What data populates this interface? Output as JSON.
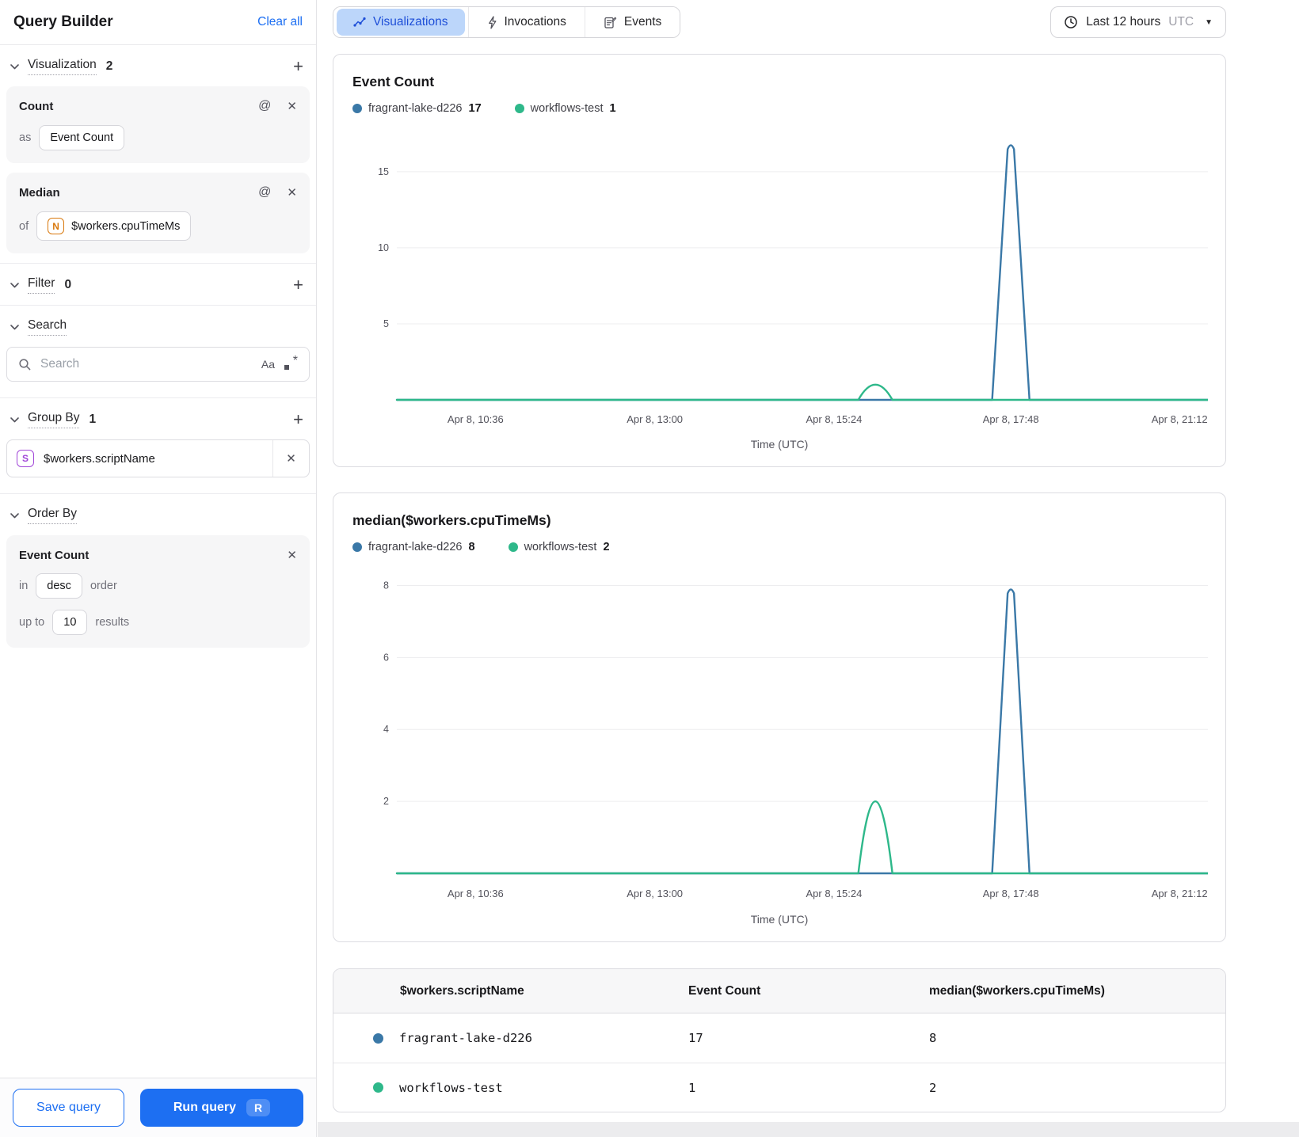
{
  "icons": {
    "at": "@",
    "close": "✕",
    "plus": "+",
    "caret_down": "▼",
    "case_sensitive": "Aa"
  },
  "colors": {
    "blue": "#3A78A7",
    "green": "#2EB88A",
    "accent": "#1D6FF2",
    "tab_active_bg": "#BCD6FA",
    "tab_active_text": "#1E4FD8",
    "badge_n": "#D9790E",
    "badge_s": "#A147D8"
  },
  "sidebar": {
    "title": "Query Builder",
    "clear_all": "Clear all",
    "sections": {
      "visualization": {
        "label": "Visualization",
        "count": "2"
      },
      "filter": {
        "label": "Filter",
        "count": "0"
      },
      "search": {
        "label": "Search"
      },
      "group_by": {
        "label": "Group By",
        "count": "1"
      },
      "order_by": {
        "label": "Order By"
      }
    },
    "visualizations": [
      {
        "name": "Count",
        "prefix": "as",
        "value": "Event Count"
      },
      {
        "name": "Median",
        "prefix": "of",
        "badge": "N",
        "value": "$workers.cpuTimeMs"
      }
    ],
    "search": {
      "placeholder": "Search"
    },
    "group_by_item": {
      "badge": "S",
      "value": "$workers.scriptName"
    },
    "order_by_card": {
      "field": "Event Count",
      "in_label": "in",
      "direction": "desc",
      "order_label": "order",
      "upto_label": "up to",
      "limit": "10",
      "results_label": "results"
    },
    "footer": {
      "save": "Save query",
      "run": "Run query",
      "shortcut": "R"
    }
  },
  "toolbar": {
    "tabs": [
      {
        "label": "Visualizations",
        "active": true
      },
      {
        "label": "Invocations",
        "active": false
      },
      {
        "label": "Events",
        "active": false
      }
    ],
    "time_range": {
      "label": "Last 12 hours",
      "timezone": "UTC"
    }
  },
  "chart_data": [
    {
      "type": "line",
      "title": "Event Count",
      "xlabel": "Time (UTC)",
      "x_ticks": [
        {
          "label": "Apr 8, 10:36",
          "f": 0.097
        },
        {
          "label": "Apr 8, 13:00",
          "f": 0.318
        },
        {
          "label": "Apr 8, 15:24",
          "f": 0.539
        },
        {
          "label": "Apr 8, 17:48",
          "f": 0.757
        },
        {
          "label": "Apr 8, 21:12",
          "f": 0.965
        }
      ],
      "y_ticks": [
        5,
        10,
        15
      ],
      "ylim": [
        0,
        17.7
      ],
      "grid": true,
      "legend_position": "top",
      "legend": [
        {
          "name": "fragrant-lake-d226",
          "value": "17",
          "color_key": "blue"
        },
        {
          "name": "workflows-test",
          "value": "1",
          "color_key": "green"
        }
      ],
      "series": [
        {
          "name": "fragrant-lake-d226",
          "color_key": "blue",
          "baseline": 0,
          "peaks": [
            {
              "time": "Apr 8, 17:48",
              "f": 0.757,
              "value": 17,
              "half_width_f": 0.023
            }
          ]
        },
        {
          "name": "workflows-test",
          "color_key": "green",
          "baseline": 0,
          "peaks": [
            {
              "time": "Apr 8, 16:00",
              "f": 0.59,
              "value": 1,
              "half_width_f": 0.021
            }
          ]
        }
      ]
    },
    {
      "type": "line",
      "title": "median($workers.cpuTimeMs)",
      "xlabel": "Time (UTC)",
      "x_ticks": [
        {
          "label": "Apr 8, 10:36",
          "f": 0.097
        },
        {
          "label": "Apr 8, 13:00",
          "f": 0.318
        },
        {
          "label": "Apr 8, 15:24",
          "f": 0.539
        },
        {
          "label": "Apr 8, 17:48",
          "f": 0.757
        },
        {
          "label": "Apr 8, 21:12",
          "f": 0.965
        }
      ],
      "y_ticks": [
        2,
        4,
        6,
        8
      ],
      "ylim": [
        0,
        8.45
      ],
      "grid": true,
      "legend_position": "top",
      "legend": [
        {
          "name": "fragrant-lake-d226",
          "value": "8",
          "color_key": "blue"
        },
        {
          "name": "workflows-test",
          "value": "2",
          "color_key": "green"
        }
      ],
      "series": [
        {
          "name": "fragrant-lake-d226",
          "color_key": "blue",
          "baseline": 0,
          "peaks": [
            {
              "time": "Apr 8, 17:48",
              "f": 0.757,
              "value": 8,
              "half_width_f": 0.023
            }
          ]
        },
        {
          "name": "workflows-test",
          "color_key": "green",
          "baseline": 0,
          "peaks": [
            {
              "time": "Apr 8, 16:00",
              "f": 0.59,
              "value": 2,
              "half_width_f": 0.021
            }
          ]
        }
      ]
    }
  ],
  "table": {
    "columns": [
      "$workers.scriptName",
      "Event Count",
      "median($workers.cpuTimeMs)"
    ],
    "rows": [
      {
        "color_key": "blue",
        "name": "fragrant-lake-d226",
        "event_count": "17",
        "median": "8"
      },
      {
        "color_key": "green",
        "name": "workflows-test",
        "event_count": "1",
        "median": "2"
      }
    ]
  }
}
